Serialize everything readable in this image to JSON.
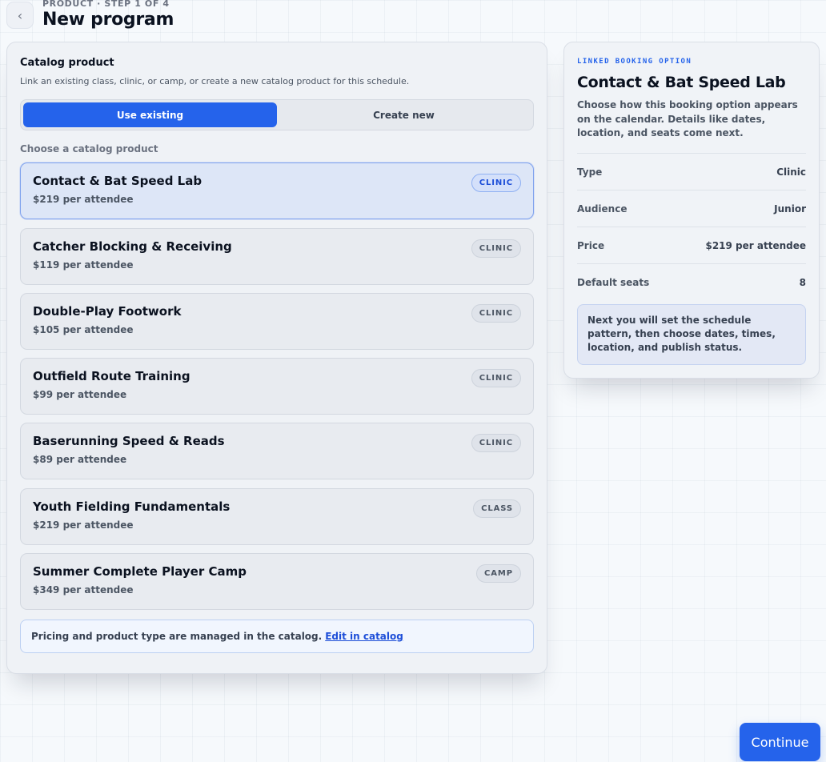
{
  "header": {
    "back_icon": "chevron-left-icon",
    "step_label": "PRODUCT · STEP 1 OF 4",
    "title": "New program"
  },
  "catalog": {
    "title": "Catalog product",
    "description": "Link an existing class, clinic, or camp, or create a new catalog product for this schedule.",
    "tabs": [
      {
        "label": "Use existing",
        "active": true
      },
      {
        "label": "Create new",
        "active": false
      }
    ],
    "choose_label": "Choose a catalog product",
    "products": [
      {
        "name": "Contact & Bat Speed Lab",
        "price": "$219 per attendee",
        "type": "CLINIC",
        "selected": true
      },
      {
        "name": "Catcher Blocking & Receiving",
        "price": "$119 per attendee",
        "type": "CLINIC",
        "selected": false
      },
      {
        "name": "Double-Play Footwork",
        "price": "$105 per attendee",
        "type": "CLINIC",
        "selected": false
      },
      {
        "name": "Outfield Route Training",
        "price": "$99 per attendee",
        "type": "CLINIC",
        "selected": false
      },
      {
        "name": "Baserunning Speed & Reads",
        "price": "$89 per attendee",
        "type": "CLINIC",
        "selected": false
      },
      {
        "name": "Youth Fielding Fundamentals",
        "price": "$219 per attendee",
        "type": "CLASS",
        "selected": false
      },
      {
        "name": "Summer Complete Player Camp",
        "price": "$349 per attendee",
        "type": "CAMP",
        "selected": false
      }
    ],
    "note_text": "Pricing and product type are managed in the catalog.",
    "note_link": "Edit in catalog"
  },
  "booking_option": {
    "kicker": "LINKED BOOKING OPTION",
    "title": "Contact & Bat Speed Lab",
    "description": "Choose how this booking option appears on the calendar. Details like dates, location, and seats come next.",
    "details": [
      {
        "label": "Type",
        "value": "Clinic"
      },
      {
        "label": "Audience",
        "value": "Junior"
      },
      {
        "label": "Price",
        "value": "$219 per attendee"
      },
      {
        "label": "Default seats",
        "value": "8"
      }
    ],
    "next_note": "Next you will set the schedule pattern, then choose dates, times, location, and publish status."
  },
  "footer": {
    "continue_label": "Continue"
  },
  "colors": {
    "accent": "#2563eb",
    "background": "#f6f9fc"
  }
}
